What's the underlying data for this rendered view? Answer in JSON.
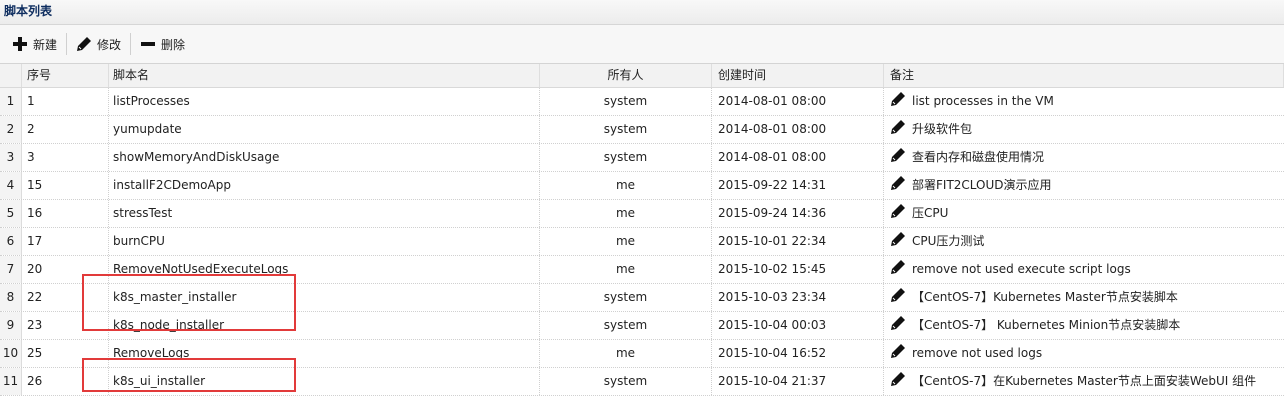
{
  "panel": {
    "title": "脚本列表"
  },
  "toolbar": {
    "new_label": "新建",
    "edit_label": "修改",
    "delete_label": "删除"
  },
  "columns": {
    "id": "序号",
    "name": "脚本名",
    "owner": "所有人",
    "created": "创建时间",
    "note": "备注"
  },
  "rows": [
    {
      "rn": "1",
      "id": "1",
      "name": "listProcesses",
      "owner": "system",
      "created": "2014-08-01 08:00",
      "note": "list processes in the VM"
    },
    {
      "rn": "2",
      "id": "2",
      "name": "yumupdate",
      "owner": "system",
      "created": "2014-08-01 08:00",
      "note": "升级软件包"
    },
    {
      "rn": "3",
      "id": "3",
      "name": "showMemoryAndDiskUsage",
      "owner": "system",
      "created": "2014-08-01 08:00",
      "note": "查看内存和磁盘使用情况"
    },
    {
      "rn": "4",
      "id": "15",
      "name": "installF2CDemoApp",
      "owner": "me",
      "created": "2015-09-22 14:31",
      "note": "部署FIT2CLOUD演示应用"
    },
    {
      "rn": "5",
      "id": "16",
      "name": "stressTest",
      "owner": "me",
      "created": "2015-09-24 14:36",
      "note": "压CPU"
    },
    {
      "rn": "6",
      "id": "17",
      "name": "burnCPU",
      "owner": "me",
      "created": "2015-10-01 22:34",
      "note": "CPU压力测试"
    },
    {
      "rn": "7",
      "id": "20",
      "name": "RemoveNotUsedExecuteLogs",
      "owner": "me",
      "created": "2015-10-02 15:45",
      "note": "remove not used execute script logs"
    },
    {
      "rn": "8",
      "id": "22",
      "name": "k8s_master_installer",
      "owner": "system",
      "created": "2015-10-03 23:34",
      "note": "【CentOS-7】Kubernetes Master节点安装脚本"
    },
    {
      "rn": "9",
      "id": "23",
      "name": "k8s_node_installer",
      "owner": "system",
      "created": "2015-10-04 00:03",
      "note": "【CentOS-7】 Kubernetes Minion节点安装脚本"
    },
    {
      "rn": "10",
      "id": "25",
      "name": "RemoveLogs",
      "owner": "me",
      "created": "2015-10-04 16:52",
      "note": "remove not used logs"
    },
    {
      "rn": "11",
      "id": "26",
      "name": "k8s_ui_installer",
      "owner": "system",
      "created": "2015-10-04 21:37",
      "note": "【CentOS-7】在Kubernetes Master节点上面安装WebUI 组件"
    }
  ],
  "colors": {
    "highlight": "#e23a3a",
    "title": "#0e2d5f"
  },
  "icons": {
    "new": "plus-icon",
    "edit": "pencil-icon",
    "delete": "minus-icon",
    "note": "pencil-icon"
  }
}
